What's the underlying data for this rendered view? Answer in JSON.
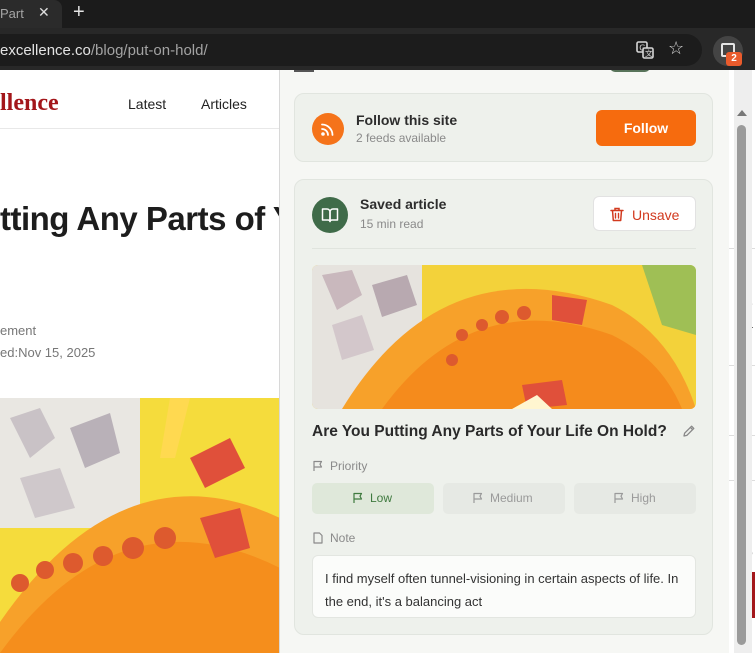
{
  "browser": {
    "tab_title": "Part",
    "url_host": "excellence.co",
    "url_path": "/blog/put-on-hold/",
    "extension_badge": "2"
  },
  "site": {
    "logo": "llence",
    "nav": [
      "Latest",
      "Articles"
    ],
    "post_title": "tting Any Parts of Y",
    "meta_category": "ement",
    "meta_published": "ed:Nov 15, 2025",
    "right_glyphs": [
      "l",
      "e",
      "a",
      "t",
      "I",
      "I",
      "f",
      "o"
    ]
  },
  "popup": {
    "follow": {
      "title": "Follow this site",
      "subtitle": "2 feeds available",
      "button": "Follow"
    },
    "saved": {
      "title": "Saved article",
      "read_time": "15 min read",
      "unsave_label": "Unsave",
      "article_title": "Are You Putting Any Parts of Your Life On Hold?",
      "priority_label": "Priority",
      "priorities": [
        "Low",
        "Medium",
        "High"
      ],
      "selected_priority": "Low",
      "note_label": "Note",
      "note_text": "I find myself often tunnel-visioning in certain aspects of life. In the end, it's a balancing act"
    },
    "colors": {
      "follow_accent": "#f66b0e",
      "saved_accent": "#3f6b49",
      "unsave_red": "#d23a1f",
      "brand_red": "#a3161a"
    }
  }
}
